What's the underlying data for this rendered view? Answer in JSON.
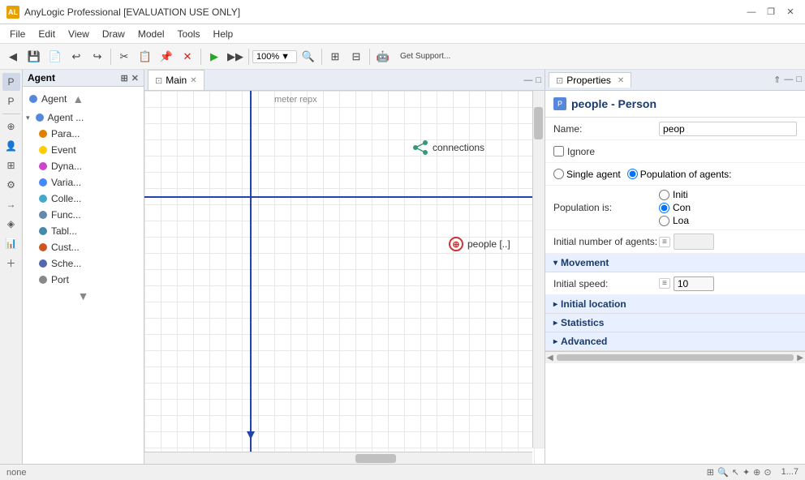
{
  "titleBar": {
    "appName": "AnyLogic Professional [EVALUATION USE ONLY]",
    "iconLabel": "AL",
    "winBtns": [
      "—",
      "❐",
      "✕"
    ]
  },
  "menuBar": {
    "items": [
      "File",
      "Edit",
      "View",
      "Draw",
      "Model",
      "Tools",
      "Help"
    ]
  },
  "toolbar": {
    "zoomLevel": "100%",
    "getSupportLabel": "Get Support..."
  },
  "agentPanel": {
    "title": "Agent",
    "items": [
      {
        "label": "Agent",
        "color": "#5588dd",
        "indent": 0
      },
      {
        "label": "Agent ...",
        "color": "#5588dd",
        "indent": 1,
        "expanded": true
      },
      {
        "label": "Para...",
        "color": "#e08000",
        "indent": 2
      },
      {
        "label": "Event",
        "color": "#ffcc00",
        "indent": 2
      },
      {
        "label": "Dyna...",
        "color": "#cc44cc",
        "indent": 2
      },
      {
        "label": "Varia...",
        "color": "#4488ff",
        "indent": 2
      },
      {
        "label": "Colle...",
        "color": "#44aacc",
        "indent": 2
      },
      {
        "label": "Func...",
        "color": "#6688aa",
        "indent": 2
      },
      {
        "label": "Tabl...",
        "color": "#4488aa",
        "indent": 2
      },
      {
        "label": "Cust...",
        "color": "#cc5522",
        "indent": 2
      },
      {
        "label": "Sche...",
        "color": "#5566aa",
        "indent": 2
      },
      {
        "label": "Port",
        "color": "#888888",
        "indent": 2
      }
    ]
  },
  "mainTab": {
    "label": "Main",
    "canvasLabel": "meter   repx"
  },
  "canvas": {
    "connectionsLabel": "connections",
    "peopleLabel": "people [..]"
  },
  "propertiesPanel": {
    "tabLabel": "Properties",
    "title": "people - Person",
    "iconLabel": "P",
    "fields": {
      "name": {
        "label": "Name:",
        "value": "peop"
      },
      "ignore": {
        "label": "Ignore"
      },
      "agentType": {
        "label": ""
      },
      "populationIs": {
        "label": "Population is:"
      },
      "initNumber": {
        "label": "Initial number of agents:"
      },
      "initialSpeed": {
        "label": "Initial speed:",
        "value": "10"
      }
    },
    "sections": {
      "movement": "Movement",
      "initialLocation": "Initial location",
      "statistics": "Statistics",
      "advanced": "Advanced"
    },
    "radioOptions": {
      "singleAgent": "Single agent",
      "populationOfAgents": "Population of agents:",
      "init": "Init",
      "con": "Con",
      "loa": "Loa"
    }
  },
  "statusBar": {
    "text": "none",
    "coords": "1...7"
  }
}
